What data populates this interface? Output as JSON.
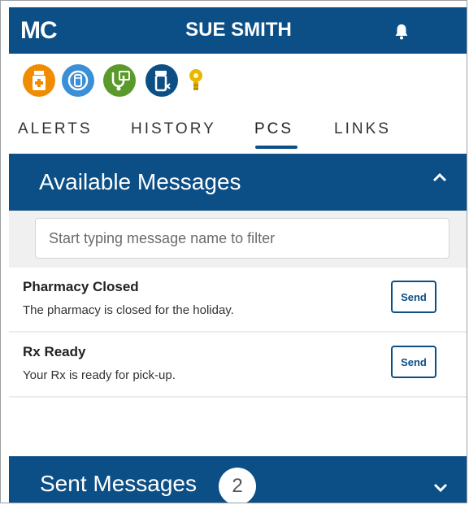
{
  "header": {
    "logo": "MC",
    "user_name": "SUE SMITH",
    "bell_icon": "bell-icon"
  },
  "toolbar_icons": [
    {
      "name": "medicine-bottle-icon",
      "color": "#f08c00"
    },
    {
      "name": "rotate-refill-icon",
      "color": "#3a8fd6"
    },
    {
      "name": "stethoscope-icon",
      "color": "#5a9a2a"
    },
    {
      "name": "prescription-bottle-icon",
      "color": "#0b4f86"
    },
    {
      "name": "lightbulb-icon",
      "color": "#e6b800"
    }
  ],
  "tabs": [
    {
      "label": "ALERTS",
      "active": false
    },
    {
      "label": "HISTORY",
      "active": false
    },
    {
      "label": "PCS",
      "active": true
    },
    {
      "label": "LINKS",
      "active": false
    }
  ],
  "available_messages": {
    "title": "Available Messages",
    "filter_placeholder": "Start typing message name to filter",
    "items": [
      {
        "name": "Pharmacy Closed",
        "description": "The pharmacy is closed for the holiday.",
        "send_label": "Send"
      },
      {
        "name": "Rx Ready",
        "description": "Your Rx is ready for pick-up.",
        "send_label": "Send"
      }
    ]
  },
  "sent_messages": {
    "title": "Sent Messages",
    "count": "2"
  },
  "colors": {
    "primary": "#0b4f86",
    "background": "#ffffff",
    "filter_area": "#f0f0f0"
  }
}
